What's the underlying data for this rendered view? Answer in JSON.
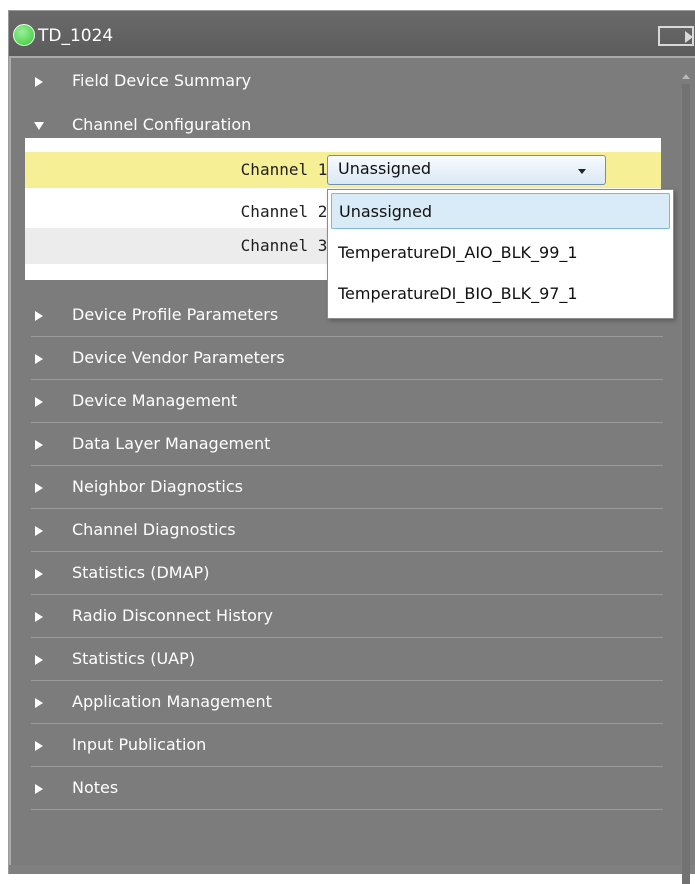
{
  "window": {
    "title": "TD_1024",
    "status_color": "#54d454"
  },
  "sections": {
    "field_device_summary": "Field Device Summary",
    "channel_configuration": "Channel Configuration",
    "collapsed": [
      "Device Profile Parameters",
      "Device Vendor Parameters",
      "Device Management",
      "Data Layer Management",
      "Neighbor Diagnostics",
      "Channel Diagnostics",
      "Statistics (DMAP)",
      "Radio Disconnect History",
      "Statistics (UAP)",
      "Application Management",
      "Input Publication",
      "Notes"
    ]
  },
  "channels": [
    {
      "label": "Channel 1:",
      "value": "Unassigned"
    },
    {
      "label": "Channel 2:"
    },
    {
      "label": "Channel 3:"
    }
  ],
  "dropdown": {
    "options": [
      "Unassigned",
      "TemperatureDI_AIO_BLK_99_1",
      "TemperatureDI_BIO_BLK_97_1"
    ],
    "selected_index": 0
  },
  "colors": {
    "highlight_row": "#f6ef96",
    "selected_option": "#d9ebf6",
    "panel_bg": "#7c7c7c"
  }
}
